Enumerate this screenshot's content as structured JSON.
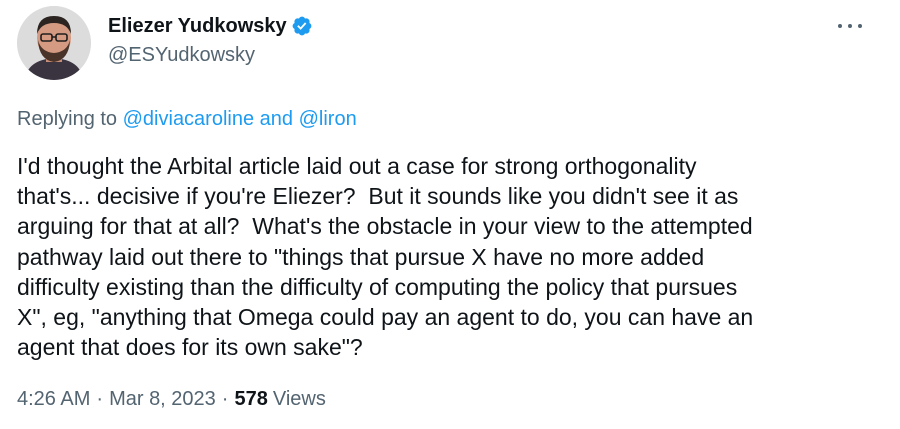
{
  "author": {
    "name": "Eliezer Yudkowsky",
    "handle": "@ESYudkowsky",
    "verified_icon": "verified-badge-icon",
    "verified_color": "#1d9bf0"
  },
  "reply": {
    "prefix": "Replying to ",
    "user1": "@diviacaroline",
    "connector": " and ",
    "user2": "@liron"
  },
  "tweet": {
    "text": "I'd thought the Arbital article laid out a case for strong orthogonality\nthat's... decisive if you're Eliezer?  But it sounds like you didn't see it as\narguing for that at all?  What's the obstacle in your view to the attempted\npathway laid out there to \"things that pursue X have no more added\ndifficulty existing than the difficulty of computing the policy that pursues\nX\", eg, \"anything that Omega could pay an agent to do, you can have an\nagent that does for its own sake\"?"
  },
  "meta": {
    "time": "4:26 AM",
    "separator": "·",
    "date": "Mar 8, 2023",
    "views_count": "578",
    "views_label": "Views"
  },
  "colors": {
    "text": "#0f1419",
    "secondary": "#536471",
    "link": "#1d9bf0"
  },
  "icons": {
    "more": "more-dots-icon",
    "avatar": "avatar"
  }
}
